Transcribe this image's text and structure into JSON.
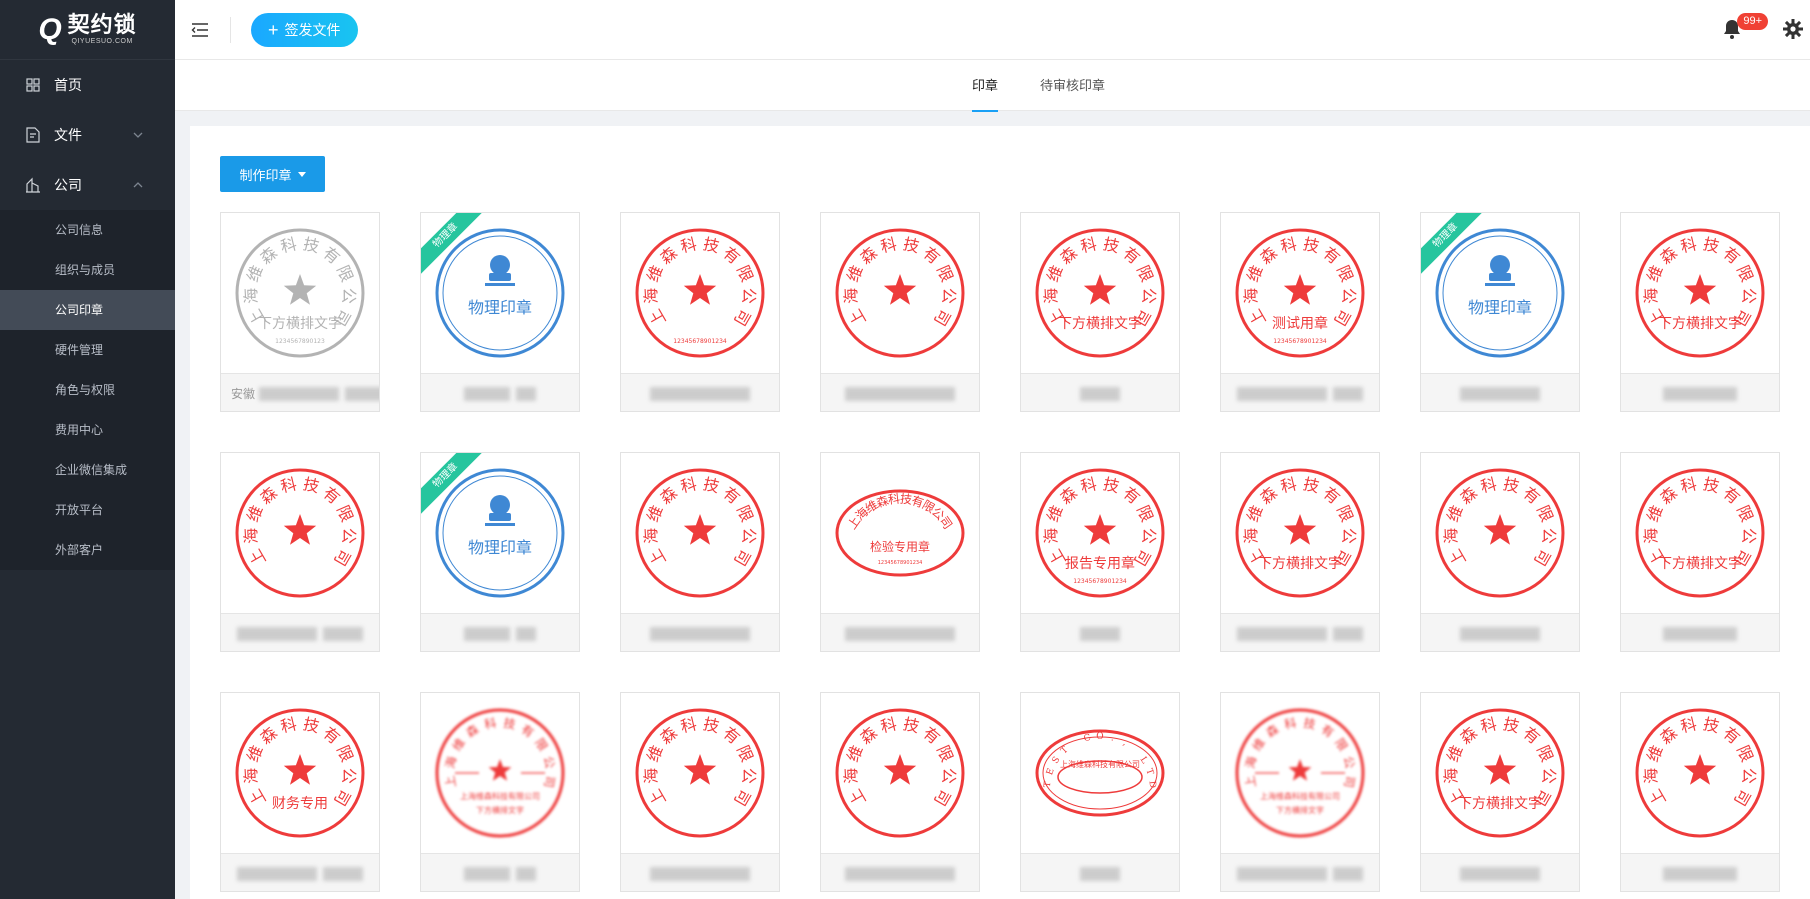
{
  "app": {
    "logo_letter": "Q",
    "logo_name": "契约锁",
    "logo_sub": "QIYUESUO.COM"
  },
  "sidebar": {
    "items": [
      {
        "label": "首页",
        "icon": "dashboard-icon"
      },
      {
        "label": "文件",
        "icon": "file-icon"
      },
      {
        "label": "公司",
        "icon": "company-icon"
      }
    ],
    "company_sub": [
      "公司信息",
      "组织与成员",
      "公司印章",
      "硬件管理",
      "角色与权限",
      "费用中心",
      "企业微信集成",
      "开放平台",
      "外部客户"
    ],
    "active_sub": "公司印章"
  },
  "topbar": {
    "send_label": "签发文件",
    "badge": "99+"
  },
  "tabs": [
    "印章",
    "待审核印章"
  ],
  "content": {
    "make_seal_label": "制作印章",
    "physical_badge": "物理章"
  },
  "seals": [
    {
      "type": "round-gray",
      "company": "上海维森科技有限公司",
      "bottom": "下方横排文字",
      "code": "1234567890123",
      "caption_prefix": "安徽"
    },
    {
      "type": "physical",
      "label": "物理印章"
    },
    {
      "type": "round",
      "company": "上海维森科技有限公司",
      "bottom": "",
      "code": "12345678901234"
    },
    {
      "type": "round",
      "company": "上海维森科技有限公司",
      "bottom": ""
    },
    {
      "type": "round",
      "company": "上海维森科技有限公司",
      "bottom": "下方横排文字"
    },
    {
      "type": "round",
      "company": "上海维森科技有限公司",
      "bottom": "测试用章",
      "code": "12345678901234"
    },
    {
      "type": "physical",
      "label": "物理印章"
    },
    {
      "type": "round",
      "company": "上海维森科技有限公司",
      "bottom": "下方横排文字"
    },
    {
      "type": "round",
      "company": "上海维森科技有限公司",
      "bottom": ""
    },
    {
      "type": "physical",
      "label": "物理印章"
    },
    {
      "type": "round",
      "company": "上海维森科技有限公司",
      "bottom": ""
    },
    {
      "type": "oval",
      "company": "上海维森科技有限公司",
      "bottom": "检验专用章",
      "code": "12345678901234"
    },
    {
      "type": "round",
      "company": "上海维森科技有限公司",
      "bottom": "报告专用章",
      "code": "12345678901234"
    },
    {
      "type": "round",
      "company": "上海维森科技有限公司",
      "bottom": "下方横排文字"
    },
    {
      "type": "round",
      "company": "上海维森科技有限公司",
      "bottom": ""
    },
    {
      "type": "round-nostar",
      "company": "上海维森科技有限公司",
      "bottom": "下方横排文字"
    },
    {
      "type": "round",
      "company": "上海维森科技有限公司",
      "bottom": "财务专用"
    },
    {
      "type": "round-blur",
      "company": "上海维森科技有限公司",
      "line2": "上海维森科技有限公司",
      "bottom": "下方横排文字"
    },
    {
      "type": "round",
      "company": "上海维森科技有限公司",
      "bottom": ""
    },
    {
      "type": "round",
      "company": "上海维森科技有限公司",
      "bottom": ""
    },
    {
      "type": "oval-en",
      "company": "TEST CO., LTD",
      "bottom": "上海维森科技有限公司"
    },
    {
      "type": "round-blur",
      "company": "上海维森科技有限公司",
      "line2": "上海维森科技有限公司",
      "bottom": "下方横排文字"
    },
    {
      "type": "round",
      "company": "上海维森科技有限公司",
      "bottom": "下方横排文字"
    },
    {
      "type": "round",
      "company": "上海维森科技有限公司",
      "bottom": ""
    }
  ],
  "colors": {
    "seal_red": "#ee3b3b",
    "seal_blue": "#3f88d4",
    "seal_gray": "#b3b3b3",
    "accent": "#1a9ae8",
    "sidebar_bg": "#242a33",
    "ribbon": "#26c59e"
  }
}
